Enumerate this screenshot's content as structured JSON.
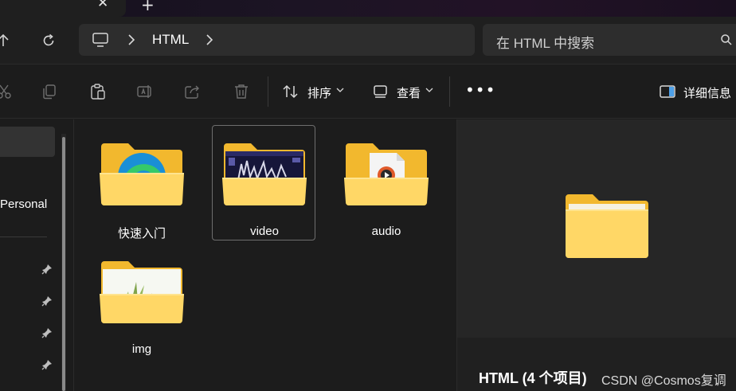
{
  "window": {
    "tab_close_glyph": "✕",
    "tab_new_glyph": "+"
  },
  "address": {
    "breadcrumb": [
      "HTML"
    ],
    "current": "HTML"
  },
  "search": {
    "placeholder": "在 HTML 中搜索"
  },
  "toolbar": {
    "icons": [
      "cut-icon",
      "copy-icon",
      "paste-icon",
      "rename-icon",
      "share-icon",
      "delete-icon"
    ],
    "sort_label": "排序",
    "view_label": "查看",
    "more_label": "•••",
    "details_label": "详细信息"
  },
  "nav": {
    "personal_label": "Personal",
    "pinned_count": 4
  },
  "items": [
    {
      "name": "快速入门",
      "thumb": "edge",
      "selected": false
    },
    {
      "name": "video",
      "thumb": "video",
      "selected": true
    },
    {
      "name": "audio",
      "thumb": "audio",
      "selected": false
    },
    {
      "name": "img",
      "thumb": "image",
      "selected": false
    }
  ],
  "details": {
    "title": "HTML (4 个项目)"
  },
  "watermark": "CSDN @Cosmos复调",
  "colors": {
    "folder_back": "#f2b82e",
    "folder_front": "#ffd766",
    "background": "#1c1c1c",
    "accent": "#4ea0e8"
  }
}
